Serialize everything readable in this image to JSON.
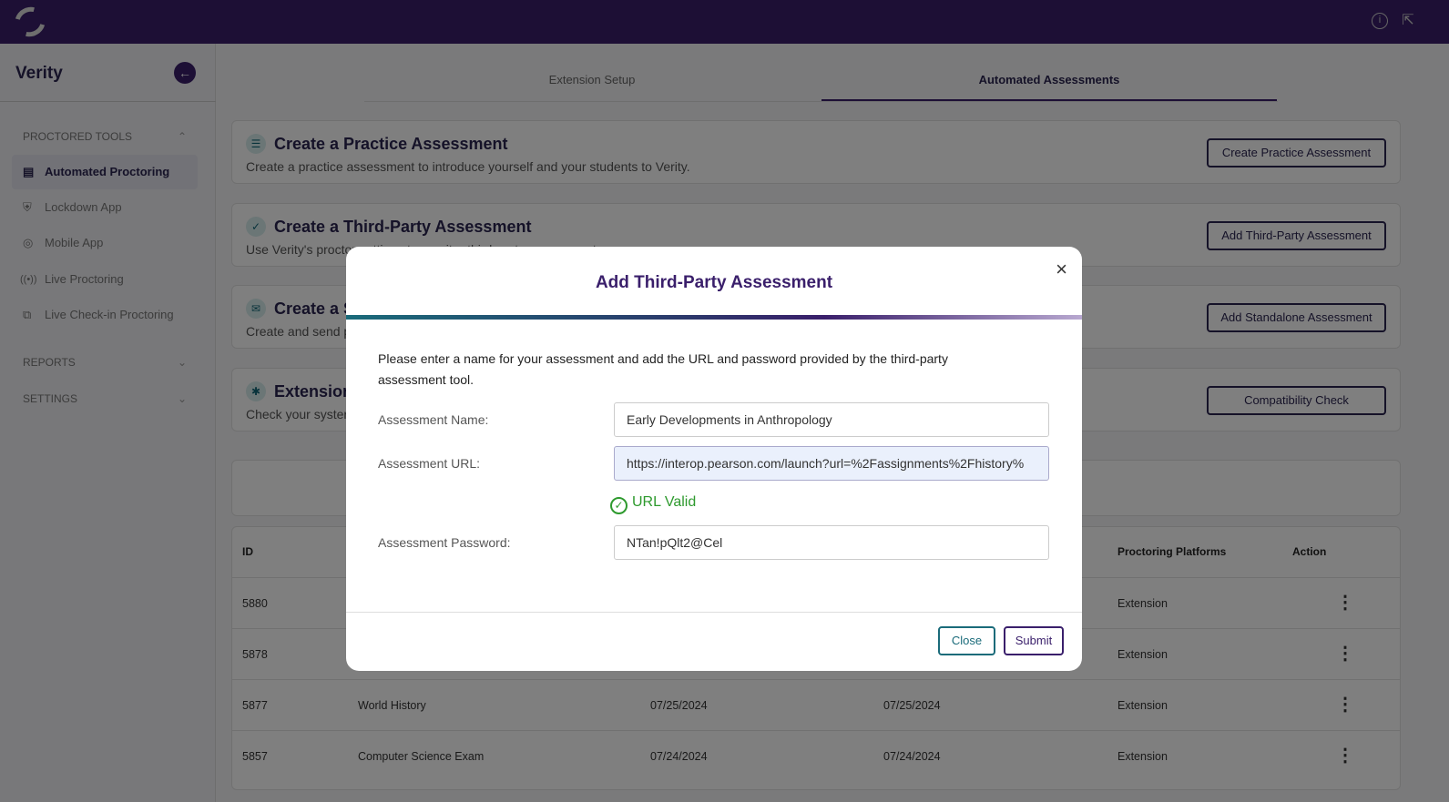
{
  "header": {
    "icons": [
      "logo-icon",
      "info-icon",
      "external-link-icon"
    ]
  },
  "sidebar": {
    "title": "Verity",
    "sections": [
      {
        "label": "PROCTORED TOOLS",
        "items": [
          {
            "label": "Automated Proctoring",
            "active": true
          },
          {
            "label": "Lockdown App"
          },
          {
            "label": "Mobile App"
          },
          {
            "label": "Live Proctoring"
          },
          {
            "label": "Live Check-in Proctoring"
          }
        ]
      },
      {
        "label": "REPORTS"
      },
      {
        "label": "SETTINGS"
      }
    ]
  },
  "tabs": [
    {
      "label": "Extension Setup"
    },
    {
      "label": "Automated Assessments",
      "active": true
    }
  ],
  "cards": [
    {
      "title": "Create a Practice Assessment",
      "desc": "Create a practice assessment to introduce yourself and your students to Verity.",
      "button": "Create Practice Assessment"
    },
    {
      "title": "Create a Third-Party Assessment",
      "desc": "Use Verity's proctor settings to monitor third-party assessments.",
      "button": "Add Third-Party Assessment"
    },
    {
      "title": "Create a S",
      "desc": "Create and send p",
      "button": "Add Standalone Assessment"
    },
    {
      "title": "Extension",
      "desc": "Check your syster",
      "button": "Compatibility Check"
    }
  ],
  "table": {
    "headers": {
      "id": "ID",
      "platforms": "Proctoring Platforms",
      "action": "Action"
    },
    "rows": [
      {
        "id": "5880",
        "name": "",
        "start": "",
        "end": "",
        "platform": "Extension"
      },
      {
        "id": "5878",
        "name": "",
        "start": "",
        "end": "",
        "platform": "Extension"
      },
      {
        "id": "5877",
        "name": "World History",
        "start": "07/25/2024",
        "end": "07/25/2024",
        "platform": "Extension"
      },
      {
        "id": "5857",
        "name": "Computer Science Exam",
        "start": "07/24/2024",
        "end": "07/24/2024",
        "platform": "Extension"
      }
    ]
  },
  "modal": {
    "title": "Add Third-Party Assessment",
    "intro": "Please enter a name for your assessment and add the URL and password provided by the third-party assessment tool.",
    "name_label": "Assessment Name:",
    "name_value": "Early Developments in Anthropology",
    "url_label": "Assessment URL:",
    "url_value": "https://interop.pearson.com/launch?url=%2Fassignments%2Fhistory%",
    "url_status": "URL Valid",
    "password_label": "Assessment Password:",
    "password_value": "NTan!pQlt2@Cel",
    "close": "Close",
    "submit": "Submit"
  },
  "colors": {
    "brand": "#3a1f6b",
    "teal": "#1a6b7a",
    "valid": "#2e9a2e"
  }
}
